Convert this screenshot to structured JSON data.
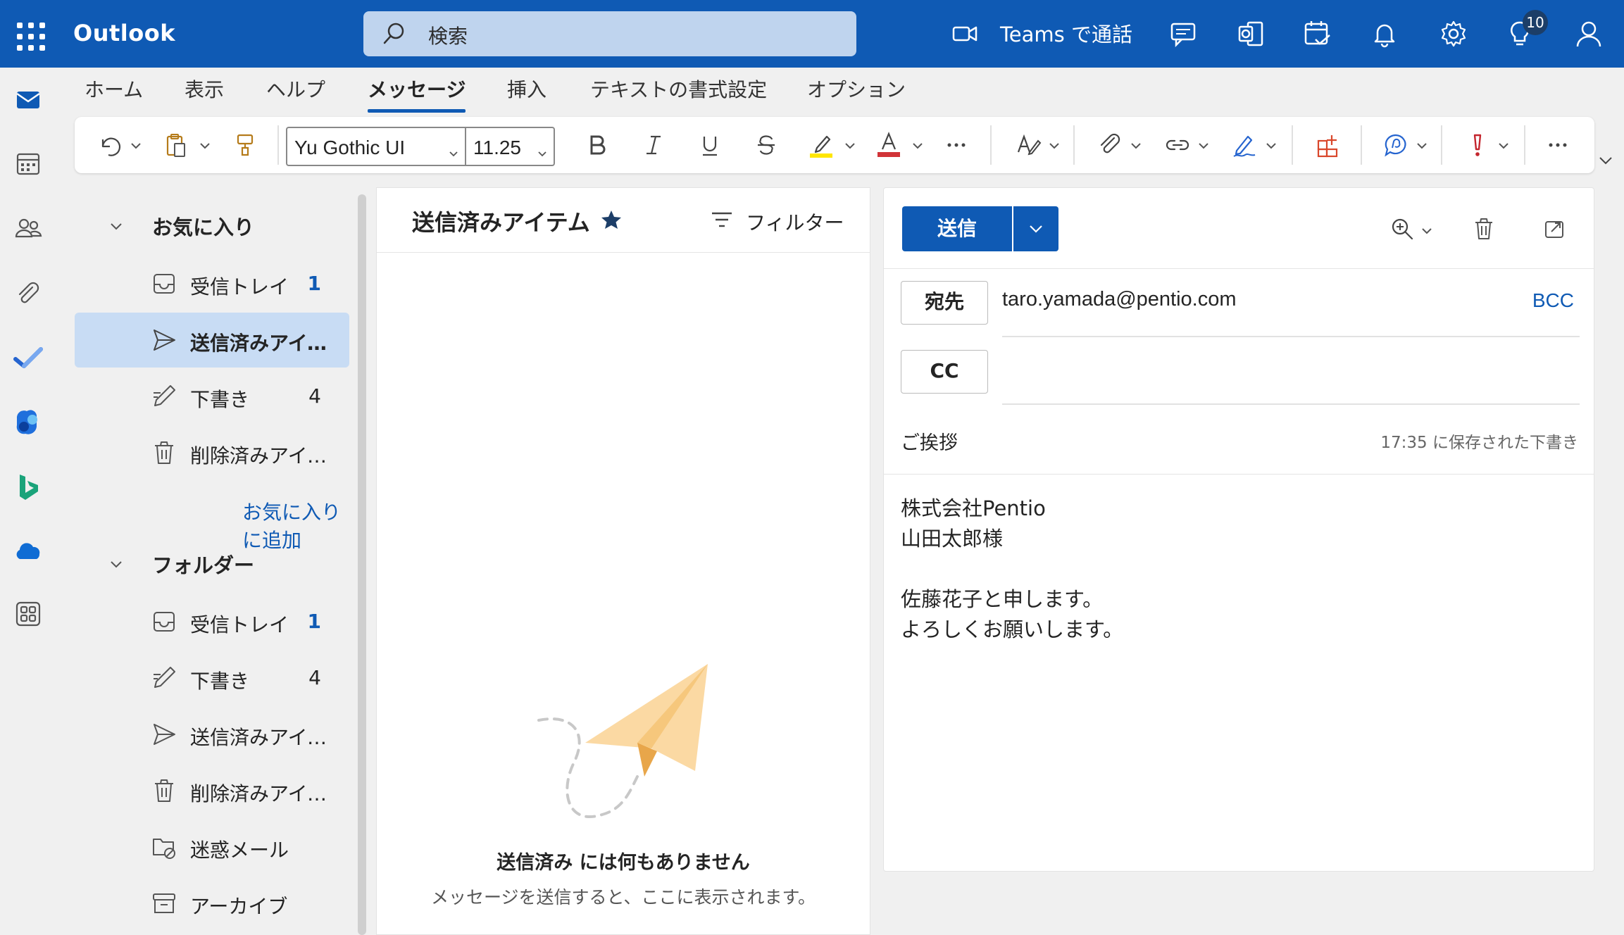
{
  "app": {
    "title": "Outlook",
    "search_placeholder": "検索",
    "teams_call_label": "Teams で通話",
    "tips_badge": "10"
  },
  "ribbon": {
    "tabs": [
      {
        "label": "ホーム"
      },
      {
        "label": "表示"
      },
      {
        "label": "ヘルプ"
      },
      {
        "label": "メッセージ"
      },
      {
        "label": "挿入"
      },
      {
        "label": "テキストの書式設定"
      },
      {
        "label": "オプション"
      }
    ],
    "active_tab": "メッセージ",
    "font_name": "Yu Gothic UI",
    "font_size": "11.25",
    "more_label": "…"
  },
  "folders": {
    "favorites_header": "お気に入り",
    "favorites": [
      {
        "label": "受信トレイ",
        "count": "1",
        "icon": "inbox-icon"
      },
      {
        "label": "送信済みアイテム",
        "count": "",
        "icon": "send-icon",
        "selected": true
      },
      {
        "label": "下書き",
        "count": "4",
        "icon": "draft-icon"
      },
      {
        "label": "削除済みアイテム",
        "count": "",
        "icon": "trash-icon"
      }
    ],
    "add_favorite_label": "お気に入りに追加",
    "folders_header": "フォルダー",
    "folder_items": [
      {
        "label": "受信トレイ",
        "count": "1",
        "icon": "inbox-icon"
      },
      {
        "label": "下書き",
        "count": "4",
        "icon": "draft-icon"
      },
      {
        "label": "送信済みアイテム",
        "count": "",
        "icon": "send-icon"
      },
      {
        "label": "削除済みアイテム",
        "count": "",
        "icon": "trash-icon"
      },
      {
        "label": "迷惑メール",
        "count": "",
        "icon": "junk-icon"
      },
      {
        "label": "アーカイブ",
        "count": "",
        "icon": "archive-icon"
      }
    ]
  },
  "message_list": {
    "title": "送信済みアイテム",
    "filter_label": "フィルター",
    "empty_title": "送信済み には何もありません",
    "empty_subtitle": "メッセージを送信すると、ここに表示されます。"
  },
  "compose": {
    "send_label": "送信",
    "to_label": "宛先",
    "to_value": "taro.yamada@pentio.com",
    "bcc_label": "BCC",
    "cc_label": "CC",
    "subject": "ご挨拶",
    "saved_status": "17:35 に保存された下書き",
    "body_lines": [
      "株式会社Pentio",
      "山田太郎様",
      "",
      "佐藤花子と申します。",
      "よろしくお願いします。"
    ]
  },
  "colors": {
    "brand": "#0f5ab4",
    "selected_bg": "#c8dcf4",
    "highlight": "#ffe600",
    "font_color": "#d13438"
  }
}
